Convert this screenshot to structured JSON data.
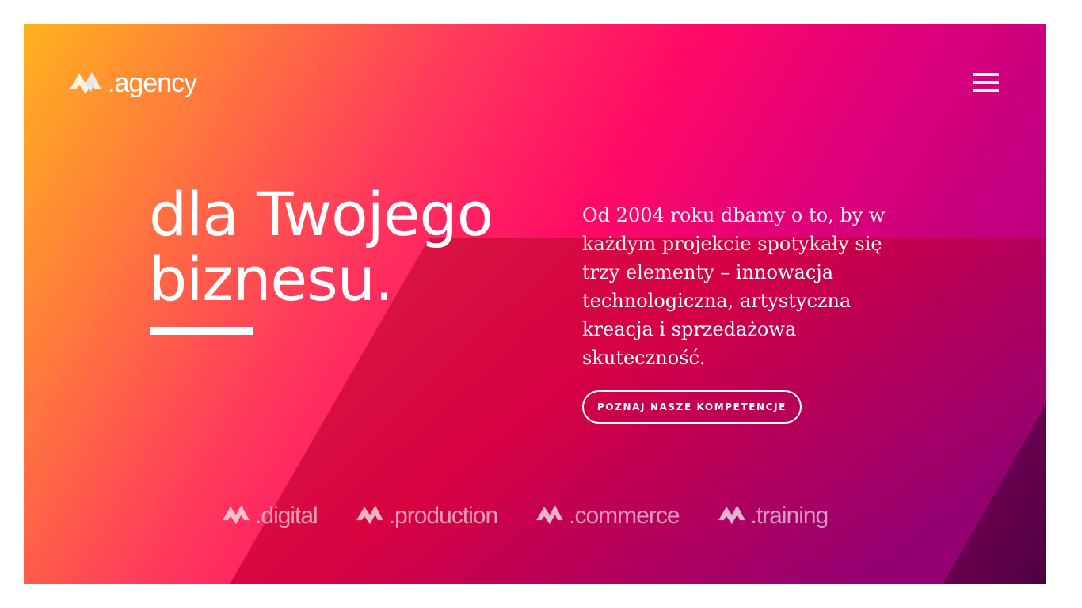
{
  "brand": {
    "logo_text": ".agency"
  },
  "nav": {
    "menu_icon": "hamburger-menu-icon"
  },
  "hero": {
    "headline_line1": "dla Twojego",
    "headline_line2": "biznesu.",
    "description_part1": "Od 2004 roku dbamy o to, by w każdym projekcie spotykały się trzy elementy – ",
    "description_highlight1": "innowacja technologiczna",
    "description_sep1": ", ",
    "description_highlight2": "artystyczna kreacja",
    "description_sep2": " i ",
    "description_highlight3": "sprzedażowa skuteczność",
    "description_end": ".",
    "cta_label": "POZNAJ NASZE KOMPETENCJE"
  },
  "subbrands": [
    {
      "label": ".digital"
    },
    {
      "label": ".production"
    },
    {
      "label": ".commerce"
    },
    {
      "label": ".training"
    }
  ],
  "colors": {
    "gradient_start": "#ffb21f",
    "gradient_mid": "#ff0a66",
    "gradient_end": "#b8007c",
    "text": "#ffffff"
  }
}
